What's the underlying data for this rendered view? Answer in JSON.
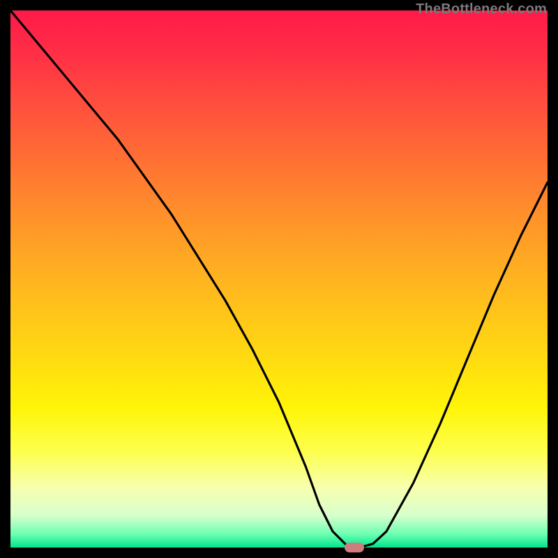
{
  "watermark": "TheBottleneck.com",
  "chart_data": {
    "type": "line",
    "title": "",
    "xlabel": "",
    "ylabel": "",
    "xlim": [
      0,
      100
    ],
    "ylim": [
      0,
      100
    ],
    "grid": false,
    "legend": false,
    "series": [
      {
        "name": "bottleneck-curve",
        "x": [
          0,
          5,
          10,
          15,
          20,
          25,
          30,
          35,
          40,
          45,
          50,
          55,
          57.5,
          60,
          62.5,
          65,
          67.5,
          70,
          75,
          80,
          85,
          90,
          95,
          100
        ],
        "values": [
          100,
          94,
          88,
          82,
          76,
          69,
          62,
          54,
          46,
          37,
          27,
          15,
          8,
          3,
          0.5,
          0,
          0.7,
          3,
          12,
          23,
          35,
          47,
          58,
          68
        ]
      }
    ],
    "annotations": [
      {
        "type": "marker",
        "x": 64,
        "y": 0,
        "label": "optimal-point"
      }
    ],
    "background_gradient": {
      "top": "#ff1a49",
      "mid": "#ffde10",
      "bottom": "#00e58c"
    }
  },
  "colors": {
    "curve": "#000000",
    "marker": "#cf7c7e",
    "frame": "#000000"
  }
}
